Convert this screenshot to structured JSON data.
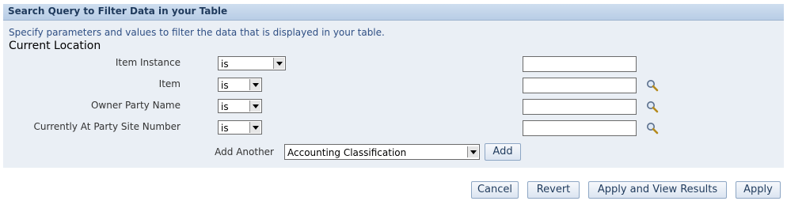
{
  "header": {
    "title": "Search Query to Filter Data in your Table"
  },
  "instructions": "Specify parameters and values to filter the data that is displayed in your table.",
  "section_title": "Current Location",
  "rows": [
    {
      "label": "Item Instance",
      "operator": "is"
    },
    {
      "label": "Item",
      "operator": "is"
    },
    {
      "label": "Owner Party Name",
      "operator": "is"
    },
    {
      "label": "Currently At Party Site Number",
      "operator": "is"
    }
  ],
  "add_another": {
    "label": "Add Another",
    "selected": "Accounting Classification",
    "button": "Add"
  },
  "actions": {
    "cancel": "Cancel",
    "revert": "Revert",
    "apply_view": "Apply and View Results",
    "apply": "Apply"
  }
}
